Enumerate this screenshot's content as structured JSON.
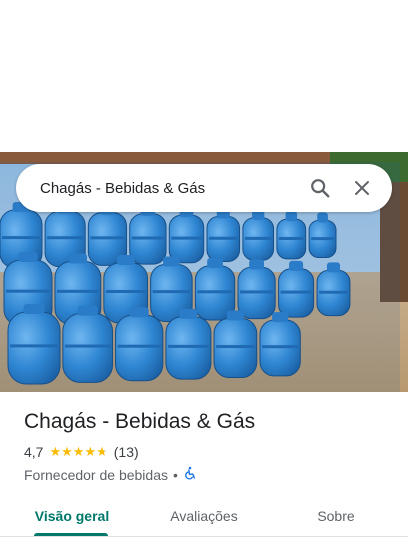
{
  "search": {
    "query": "Chagás - Bebidas & Gás"
  },
  "hero": {
    "photo": "blue-gas-cylinders-photo"
  },
  "place": {
    "name": "Chagás - Bebidas & Gás",
    "rating": "4,7",
    "rating_fraction": 0.94,
    "review_count": "(13)",
    "category": "Fornecedor de bebidas",
    "separator": "•",
    "accessibility_icon": "wheelchair-icon"
  },
  "tabs": [
    {
      "label": "Visão geral",
      "active": true
    },
    {
      "label": "Avaliações",
      "active": false
    },
    {
      "label": "Sobre",
      "active": false
    }
  ],
  "colors": {
    "accent": "#00796b",
    "star": "#fbbc04",
    "accessibility": "#1a73e8"
  }
}
